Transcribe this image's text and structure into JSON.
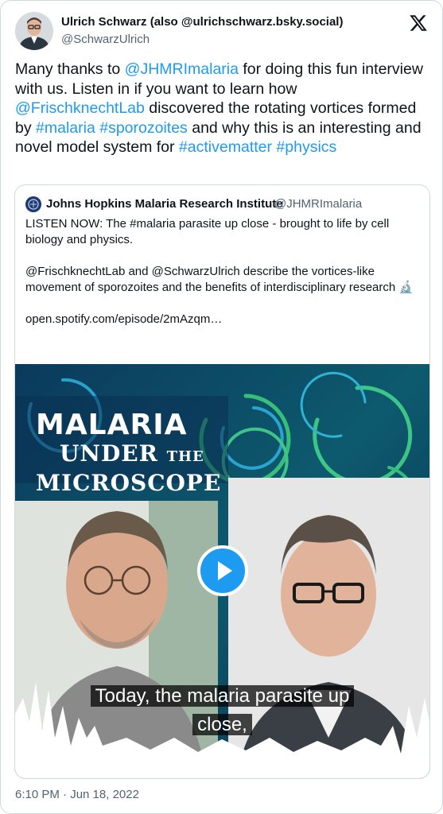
{
  "author": {
    "name": "Ulrich Schwarz (also @ulrichschwarz.bsky.social)",
    "handle": "@SchwarzUlrich"
  },
  "tweet": {
    "segments": [
      {
        "text": "Many thanks to ",
        "link": false
      },
      {
        "text": "@JHMRImalaria",
        "link": true
      },
      {
        "text": " for doing this fun interview with us. Listen in if you want to learn how ",
        "link": false
      },
      {
        "text": "@FrischknechtLab",
        "link": true
      },
      {
        "text": " discovered the rotating vortices formed by ",
        "link": false
      },
      {
        "text": "#malaria",
        "link": true
      },
      {
        "text": " ",
        "link": false
      },
      {
        "text": "#sporozoites",
        "link": true
      },
      {
        "text": " and why this is an interesting and novel model system for ",
        "link": false
      },
      {
        "text": "#activematter",
        "link": true
      },
      {
        "text": " ",
        "link": false
      },
      {
        "text": "#physics",
        "link": true
      }
    ],
    "timestamp": "6:10 PM · Jun 18, 2022"
  },
  "quote": {
    "name": "Johns Hopkins Malaria Research Institute",
    "handle": "@JHMRImalaria",
    "paragraph1": "LISTEN NOW: The #malaria parasite up close - brought to life by cell biology and physics.",
    "paragraph2": "@FrischknechtLab and @SchwarzUlrich describe the vortices-like movement of sporozoites and the benefits of interdisciplinary research 🔬",
    "link": "open.spotify.com/episode/2mAzqm…"
  },
  "media": {
    "title_line1": "MALARIA",
    "title_line2": "UNDER",
    "title_the": "THE",
    "title_line3": "MICROSCOPE",
    "caption_line1": "Today, the malaria parasite up",
    "caption_line2": "close,"
  },
  "colors": {
    "link": "#1d9bf0",
    "secondary_text": "#536471",
    "border": "#cfd9de"
  },
  "icons": {
    "brand": "x-logo-icon",
    "play": "play-icon"
  }
}
